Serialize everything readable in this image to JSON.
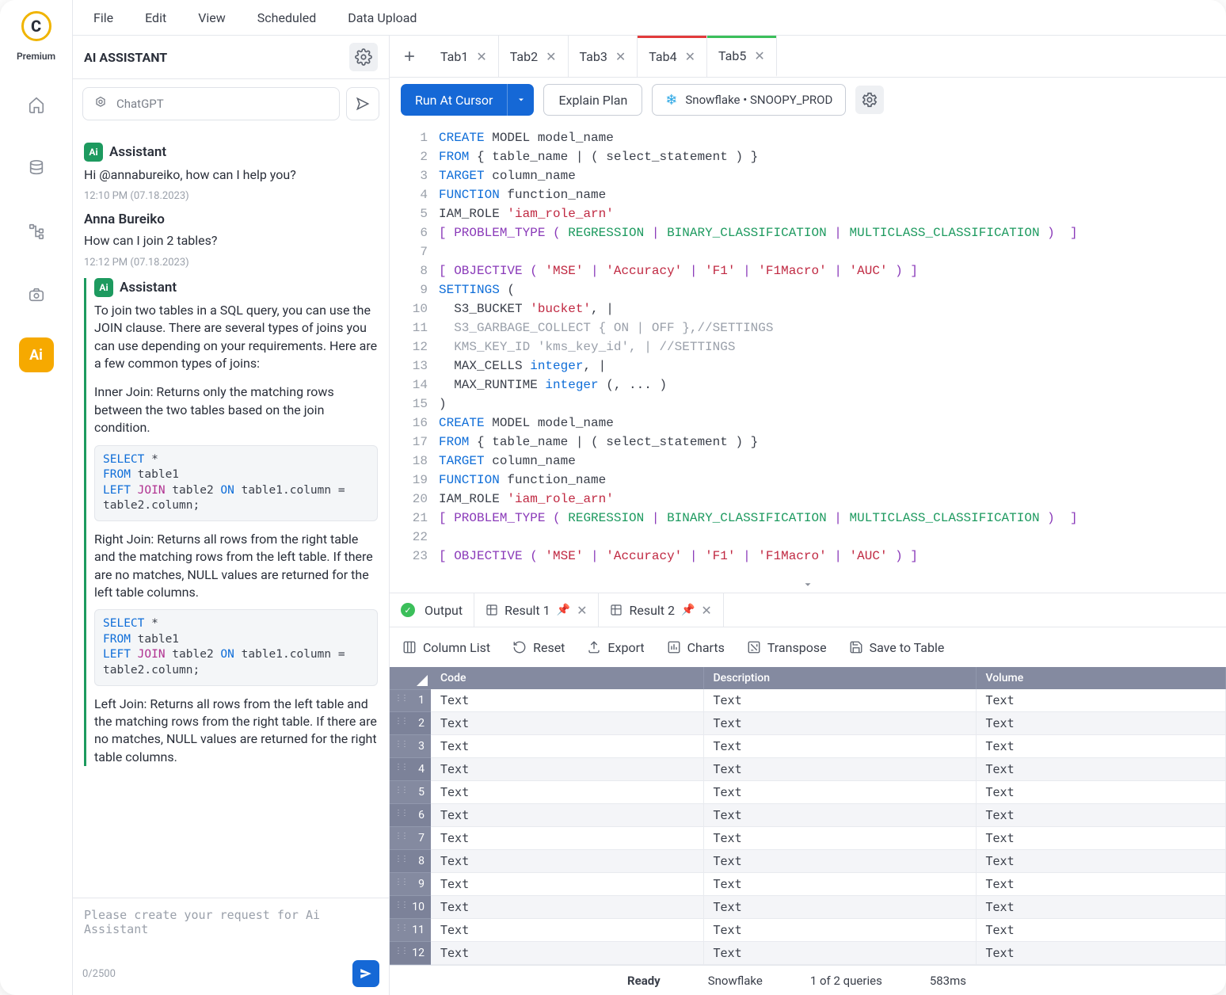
{
  "rail": {
    "premium": "Premium",
    "ai_label": "Ai"
  },
  "menubar": [
    "File",
    "Edit",
    "View",
    "Scheduled",
    "Data Upload"
  ],
  "assistant": {
    "title": "AI ASSISTANT",
    "model": "ChatGPT",
    "messages": {
      "m1_from": "Assistant",
      "m1_text": "Hi @annabureiko, how can I help you?",
      "m1_time": "12:10 PM (07.18.2023)",
      "m2_from": "Anna Bureiko",
      "m2_text": "How can I join 2 tables?",
      "m2_time": "12:12 PM (07.18.2023)",
      "m3_from": "Assistant",
      "m3_p1": "To join two tables in a SQL query, you can use the JOIN clause. There are several types of joins you can use depending on your requirements. Here are a few common types of joins:",
      "m3_p2": "Inner Join: Returns only the matching rows between the two tables based on the join condition.",
      "m3_p3": "Right Join: Returns all rows from the right table and the matching rows from the left table. If there are no matches, NULL values are returned for the left table columns.",
      "m3_p4": "Left Join: Returns all rows from the left table and the matching rows from the right table. If there are no matches, NULL values are returned for the right table columns."
    },
    "compose_placeholder": "Please create your request for Ai Assistant",
    "char_count": "0/2500"
  },
  "tabs": [
    {
      "label": "Tab1"
    },
    {
      "label": "Tab2"
    },
    {
      "label": "Tab3"
    },
    {
      "label": "Tab4"
    },
    {
      "label": "Tab5"
    }
  ],
  "runbar": {
    "run": "Run At Cursor",
    "explain": "Explain Plan",
    "connection": "Snowflake • SNOOPY_PROD"
  },
  "code_raw": [
    "CREATE MODEL model_name",
    "FROM { table_name | ( select_statement ) }",
    "TARGET column_name",
    "FUNCTION function_name",
    "IAM_ROLE 'iam_role_arn'",
    "[ PROBLEM_TYPE ( REGRESSION | BINARY_CLASSIFICATION | MULTICLASS_CLASSIFICATION )  ]",
    "",
    "[ OBJECTIVE ( 'MSE' | 'Accuracy' | 'F1' | 'F1Macro' | 'AUC' ) ]",
    "SETTINGS (",
    "  S3_BUCKET 'bucket', |",
    "  S3_GARBAGE_COLLECT { ON | OFF },//SETTINGS",
    "  KMS_KEY_ID 'kms_key_id', | //SETTINGS",
    "  MAX_CELLS integer, |",
    "  MAX_RUNTIME integer (, ... )",
    ")",
    "CREATE MODEL model_name",
    "FROM { table_name | ( select_statement ) }",
    "TARGET column_name",
    "FUNCTION function_name",
    "IAM_ROLE 'iam_role_arn'",
    "[ PROBLEM_TYPE ( REGRESSION | BINARY_CLASSIFICATION | MULTICLASS_CLASSIFICATION )  ]",
    "",
    "[ OBJECTIVE ( 'MSE' | 'Accuracy' | 'F1' | 'F1Macro' | 'AUC' ) ]"
  ],
  "result_tabs": {
    "output": "Output",
    "r1": "Result 1",
    "r2": "Result 2"
  },
  "result_toolbar": {
    "column_list": "Column List",
    "reset": "Reset",
    "export": "Export",
    "charts": "Charts",
    "transpose": "Transpose",
    "save": "Save to Table"
  },
  "grid": {
    "columns": [
      "Code",
      "Description",
      "Volume"
    ],
    "rows": [
      [
        "Text",
        "Text",
        "Text"
      ],
      [
        "Text",
        "Text",
        "Text"
      ],
      [
        "Text",
        "Text",
        "Text"
      ],
      [
        "Text",
        "Text",
        "Text"
      ],
      [
        "Text",
        "Text",
        "Text"
      ],
      [
        "Text",
        "Text",
        "Text"
      ],
      [
        "Text",
        "Text",
        "Text"
      ],
      [
        "Text",
        "Text",
        "Text"
      ],
      [
        "Text",
        "Text",
        "Text"
      ],
      [
        "Text",
        "Text",
        "Text"
      ],
      [
        "Text",
        "Text",
        "Text"
      ],
      [
        "Text",
        "Text",
        "Text"
      ]
    ]
  },
  "statusbar": {
    "ready": "Ready",
    "conn": "Snowflake",
    "queries": "1 of 2 queries",
    "time": "583ms"
  }
}
